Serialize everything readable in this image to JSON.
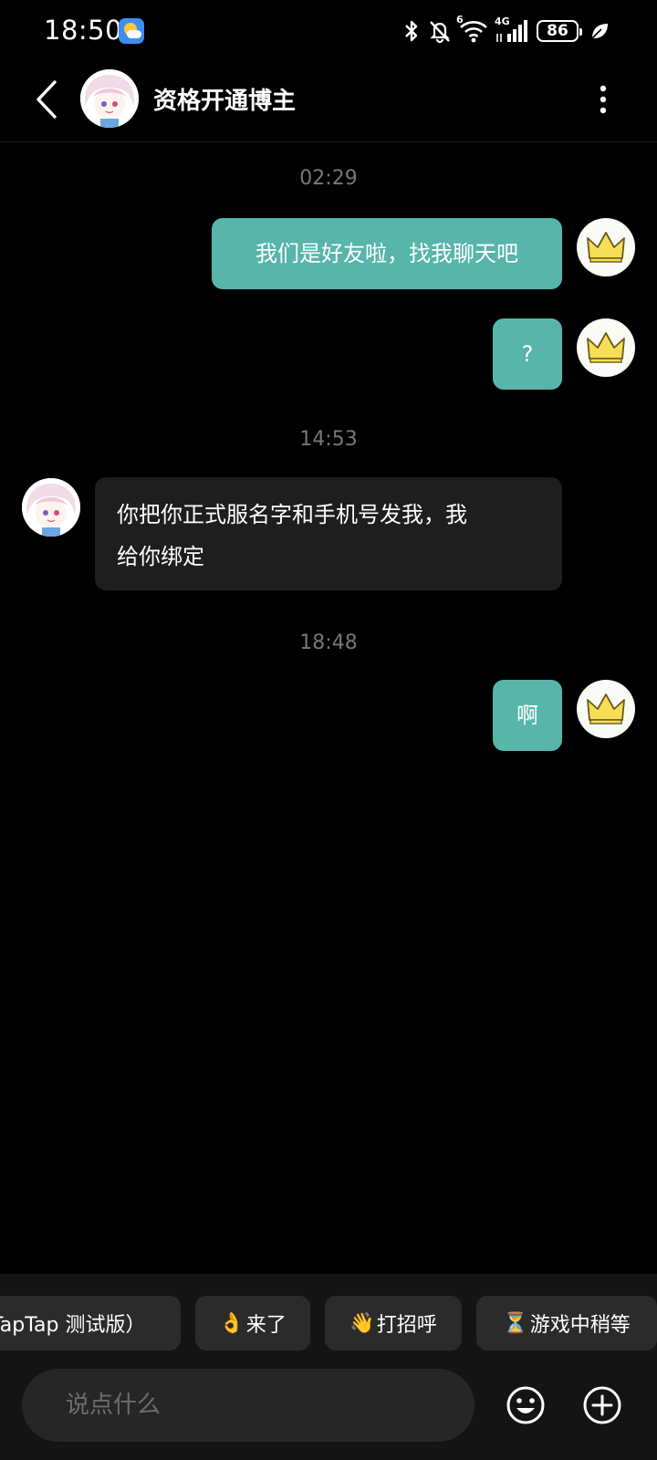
{
  "status_bar": {
    "time": "18:50",
    "battery": "86",
    "network": "4G",
    "wifi_badge": "6",
    "icons": [
      "weather-icon",
      "bluetooth-icon",
      "mute-icon",
      "wifi-icon",
      "signal-icon",
      "battery-icon",
      "leaf-icon"
    ]
  },
  "header": {
    "title": "资格开通博主",
    "icons": [
      "back-arrow-icon",
      "more-vertical-icon"
    ]
  },
  "messages": [
    {
      "kind": "time",
      "text": "02:29"
    },
    {
      "kind": "message",
      "direction": "outgoing",
      "text": "我们是好友啦，找我聊天吧"
    },
    {
      "kind": "message",
      "direction": "outgoing",
      "text": "?"
    },
    {
      "kind": "time",
      "text": "14:53"
    },
    {
      "kind": "message",
      "direction": "incoming",
      "line1": "你把你正式服名字和手机号发我，我",
      "line2": "给你绑定"
    },
    {
      "kind": "time",
      "text": "18:48"
    },
    {
      "kind": "message",
      "direction": "outgoing",
      "text": "啊"
    }
  ],
  "quick_replies": [
    {
      "emoji": "",
      "label": "TapTap 测试版）"
    },
    {
      "emoji": "👌",
      "label": "来了"
    },
    {
      "emoji": "👋",
      "label": "打招呼"
    },
    {
      "emoji": "⏳",
      "label": "游戏中稍等"
    }
  ],
  "composer": {
    "placeholder": "说点什么",
    "icons": [
      "emoji-smile-icon",
      "add-circle-icon"
    ]
  },
  "colors": {
    "background": "#000000",
    "outgoing_bubble": "#57b5a9",
    "incoming_bubble": "#1e1e1e",
    "timestamp": "#777777",
    "chip": "#2b2b2b"
  }
}
